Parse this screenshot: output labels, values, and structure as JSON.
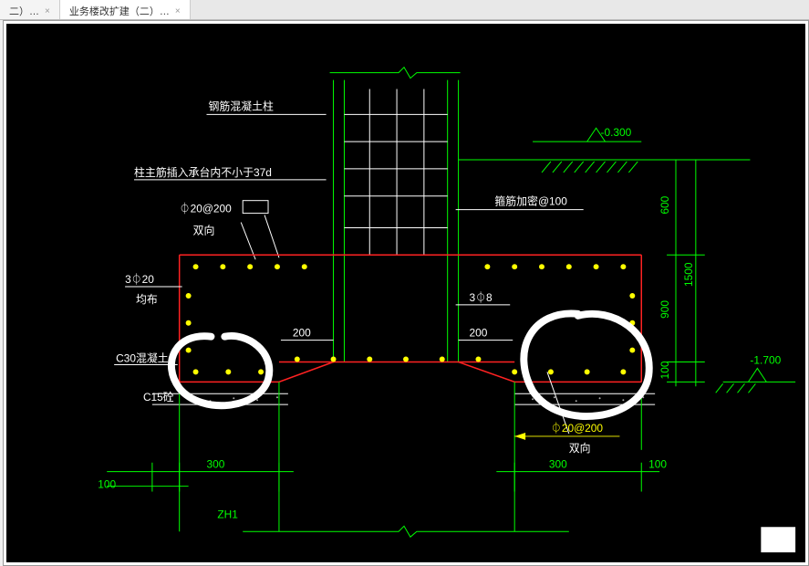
{
  "tabs": {
    "t1": {
      "label": "二）…",
      "close": "×"
    },
    "t2": {
      "label": "业务楼改扩建（二）…",
      "close": "×"
    }
  },
  "labels": {
    "column": "钢筋混凝土柱",
    "anchorage": "柱主筋插入承台内不小于37d",
    "topRebar": "⏀20@200",
    "topDir": "双向",
    "stirrup": "箍筋加密@100",
    "leftBar": "3⏀20",
    "leftDist": "均布",
    "c30": "C30混凝土",
    "c15": "C15砼",
    "tieBar": "3⏀8",
    "botRebar": "⏀20@200",
    "botDir": "双向",
    "zh1": "ZH1"
  },
  "dims": {
    "d200a": "200",
    "d200b": "200",
    "d300a": "300",
    "d300b": "300",
    "d100a": "100",
    "d100b": "100",
    "d100c": "100",
    "d600": "600",
    "d900": "900",
    "d1500": "1500"
  },
  "elev": {
    "top": "-0.300",
    "bottom": "-1.700"
  },
  "annot": {
    "circle1": "highlight-left",
    "circle2": "highlight-right"
  }
}
